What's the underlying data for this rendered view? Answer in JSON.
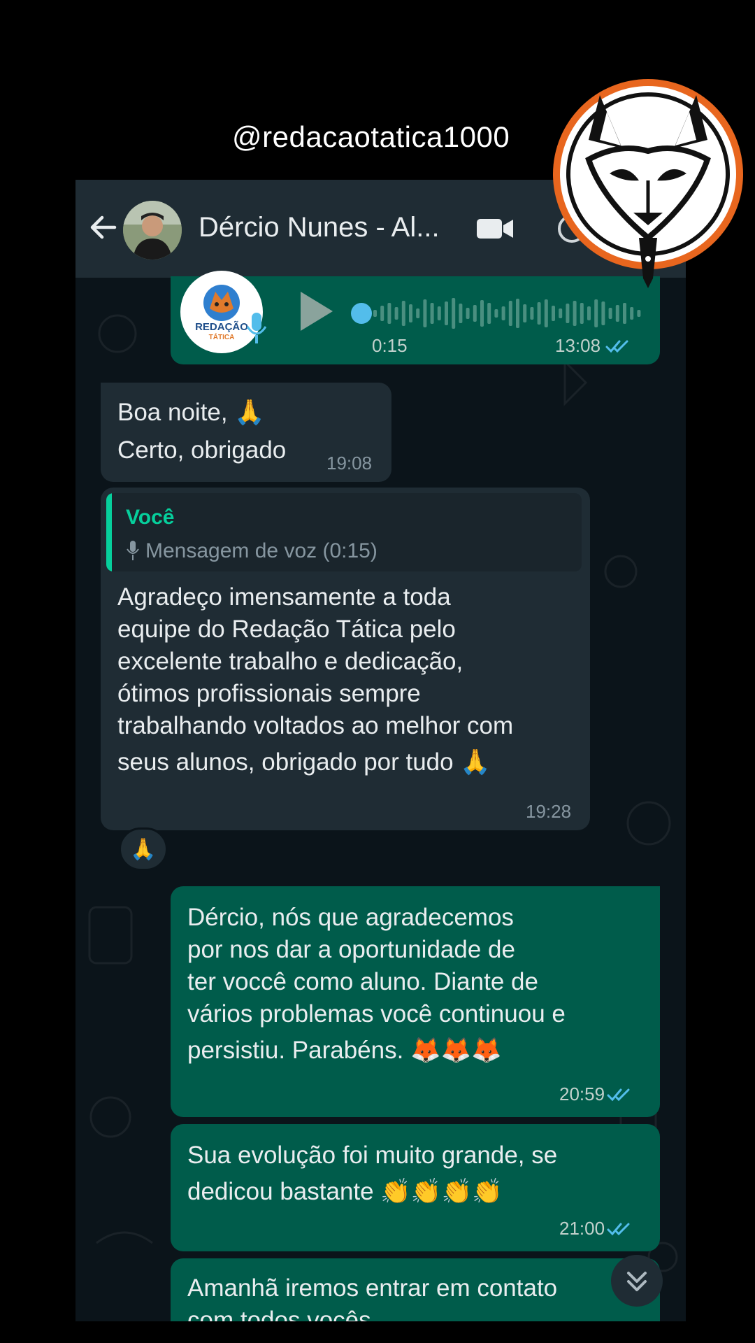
{
  "watermark": {
    "handle": "@redacaotatica1000",
    "logo_icon": "fox-pen-logo"
  },
  "header": {
    "back_icon": "arrow-left-icon",
    "avatar_icon": "contact-avatar",
    "contact_name": "Dércio Nunes - Al...",
    "video_icon": "video-camera-icon",
    "call_icon": "phone-call-icon"
  },
  "messages": {
    "voice": {
      "duration": "0:15",
      "time": "13:08",
      "logo_text_1": "REDAÇÃO",
      "logo_text_2": "TÁTICA"
    },
    "m1": {
      "lines": [
        "Boa noite, 🙏",
        "Certo, obrigado"
      ],
      "time": "19:08"
    },
    "m2": {
      "quote_sender": "Você",
      "quote_text": "Mensagem de voz (0:15)",
      "lines": [
        "Agradeço imensamente a toda",
        "equipe do Redação Tática pelo",
        "excelente trabalho e  dedicação,",
        "ótimos profissionais sempre",
        "trabalhando voltados ao melhor com",
        "seus alunos, obrigado por tudo 🙏"
      ],
      "time": "19:28",
      "reaction": "🙏"
    },
    "m3": {
      "lines": [
        "Dércio, nós que agradecemos",
        "por nos dar a oportunidade de",
        "ter voccê como aluno. Diante de",
        "vários problemas você continuou e",
        "persistiu. Parabéns. 🦊🦊🦊"
      ],
      "time": "20:59"
    },
    "m4": {
      "lines": [
        "Sua evolução foi muito grande, se",
        "dedicou bastante 👏👏👏👏"
      ],
      "time": "21:00"
    },
    "m5": {
      "lines": [
        "Amanhã iremos entrar em contato",
        "com todos vocês"
      ]
    }
  },
  "colors": {
    "background": "#0b141a",
    "header": "#1f2c34",
    "outgoing": "#005c4b",
    "incoming": "#1f2c34",
    "accent": "#06cf9c",
    "read_ticks": "#53bdeb"
  }
}
